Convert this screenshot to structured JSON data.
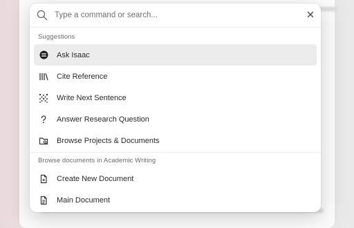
{
  "search": {
    "placeholder": "Type a command or search...",
    "value": ""
  },
  "sections": [
    {
      "title": "Suggestions",
      "items": [
        {
          "label": "Ask Isaac",
          "icon": "isaac-icon",
          "active": true
        },
        {
          "label": "Cite Reference",
          "icon": "library-icon"
        },
        {
          "label": "Write Next Sentence",
          "icon": "sparkle-dots-icon"
        },
        {
          "label": "Answer Research Question",
          "icon": "question-mark-icon"
        },
        {
          "label": "Browse Projects & Documents",
          "icon": "folder-search-icon"
        }
      ]
    },
    {
      "title": "Browse documents in Academic Writing",
      "items": [
        {
          "label": "Create New Document",
          "icon": "new-document-icon"
        },
        {
          "label": "Main Document",
          "icon": "document-icon"
        }
      ]
    }
  ],
  "colors": {
    "active_item_bg": "#ececec",
    "text": "#2a2a2a",
    "section_title": "#6b6b6b"
  }
}
